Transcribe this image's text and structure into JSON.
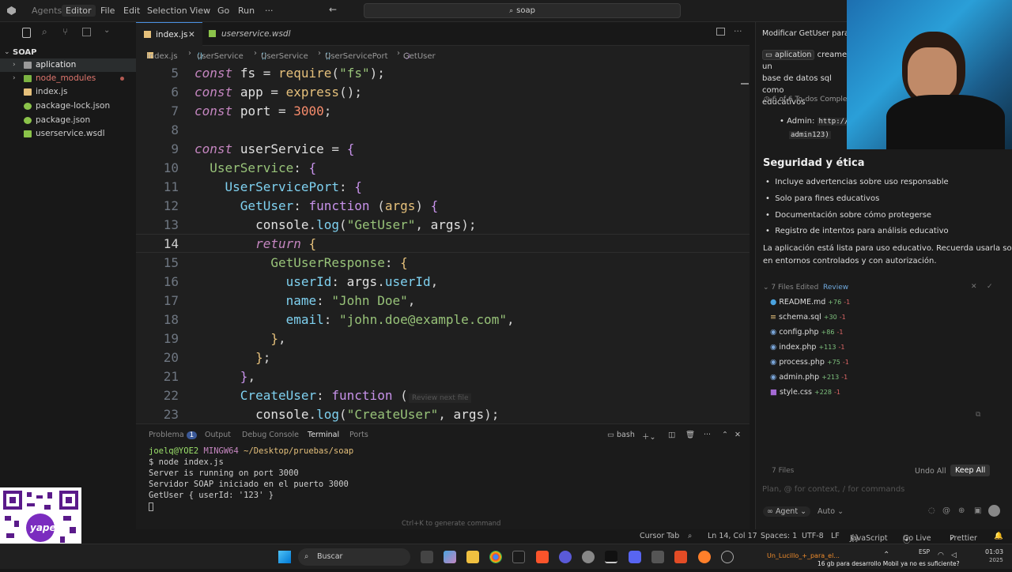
{
  "menu": {
    "agents": "Agents",
    "editor": "Editor",
    "items": [
      "File",
      "Edit",
      "Selection",
      "View",
      "Go",
      "Run",
      "···"
    ],
    "search": "soap"
  },
  "sidebar": {
    "root": "SOAP",
    "items": [
      {
        "label": "aplication",
        "type": "folder",
        "color": "#e8e8e8"
      },
      {
        "label": "node_modules",
        "type": "folder",
        "color": "#e0766e"
      },
      {
        "label": "index.js",
        "type": "js",
        "color": "#cfcfcf"
      },
      {
        "label": "package-lock.json",
        "type": "json",
        "color": "#cfcfcf"
      },
      {
        "label": "package.json",
        "type": "json",
        "color": "#cfcfcf"
      },
      {
        "label": "userservice.wsdl",
        "type": "wsdl",
        "color": "#cfcfcf"
      }
    ]
  },
  "tabs": [
    {
      "label": "index.js",
      "active": true
    },
    {
      "label": "userservice.wsdl",
      "active": false
    }
  ],
  "breadcrumb": [
    "index.js",
    "userService",
    "UserService",
    "UserServicePort",
    "GetUser"
  ],
  "editor": {
    "lines": [
      "5",
      "6",
      "7",
      "8",
      "9",
      "10",
      "11",
      "12",
      "13",
      "14",
      "15",
      "16",
      "17",
      "18",
      "19",
      "20",
      "21",
      "22",
      "23"
    ],
    "hint": "Review next file"
  },
  "panel": {
    "tabs": [
      "Problema",
      "Output",
      "Debug Console",
      "Terminal",
      "Ports"
    ],
    "problems_count": "1",
    "shell": "bash",
    "prompt_user": "joelq@YOE2",
    "prompt_env": "MINGW64",
    "prompt_path": "~/Desktop/pruebas/soap",
    "lines": [
      "$ node index.js",
      "Server is running on port 3000",
      "Servidor SOAP iniciado en el puerto 3000",
      "GetUser { userId: '123' }"
    ],
    "hint": "Ctrl+K to generate command"
  },
  "status": {
    "cursor_tab": "Cursor Tab",
    "position": "Ln 14, Col 17",
    "spaces": "Spaces: 1",
    "encoding": "UTF-8",
    "eol": "LF",
    "lang": "JavaScript",
    "golive": "Go Live",
    "prettier": "Prettier"
  },
  "chat": {
    "title": "Modificar GetUser para c",
    "context_chip": "aplication",
    "message": "creame un",
    "message2": "base de datos sql como",
    "message3": "educativos",
    "todos": "6 of 6 To-dos Comple",
    "admin_label": "Admin:",
    "admin_url": "http://",
    "admin_pass": "admin123)",
    "section": "Seguridad y ética",
    "bullets": [
      "Incluye advertencias sobre uso responsable",
      "Solo para fines educativos",
      "Documentación sobre cómo protegerse",
      "Registro de intentos para análisis educativo"
    ],
    "summary1": "La aplicación está lista para uso educativo. Recuerda usarla solo",
    "summary2": "en entornos controlados y con autorización.",
    "files_header": "7 Files Edited",
    "review": "Review",
    "files": [
      {
        "name": "README.md",
        "add": "+76",
        "del": "-1",
        "color": "#4aa3df"
      },
      {
        "name": "schema.sql",
        "add": "+30",
        "del": "-1",
        "color": "#e5c07b"
      },
      {
        "name": "config.php",
        "add": "+86",
        "del": "-1",
        "color": "#7aa6da"
      },
      {
        "name": "index.php",
        "add": "+113",
        "del": "-1",
        "color": "#7aa6da"
      },
      {
        "name": "process.php",
        "add": "+75",
        "del": "-1",
        "color": "#7aa6da"
      },
      {
        "name": "admin.php",
        "add": "+213",
        "del": "-1",
        "color": "#7aa6da"
      },
      {
        "name": "style.css",
        "add": "+228",
        "del": "-1",
        "color": "#a46ad4"
      }
    ],
    "files_count": "7 Files",
    "undo_all": "Undo All",
    "keep_all": "Keep All",
    "input_placeholder": "Plan, @ for context, / for commands",
    "mode": "Agent",
    "model": "Auto"
  },
  "taskbar": {
    "search": "Buscar",
    "media": "Un_Lucillo_+_para_el...",
    "media2": "16 gb para desarrollo Mobil ya no es suficiente?",
    "lang": "ESP",
    "time": "01:03",
    "date": "2025"
  },
  "qr_label": "yape"
}
